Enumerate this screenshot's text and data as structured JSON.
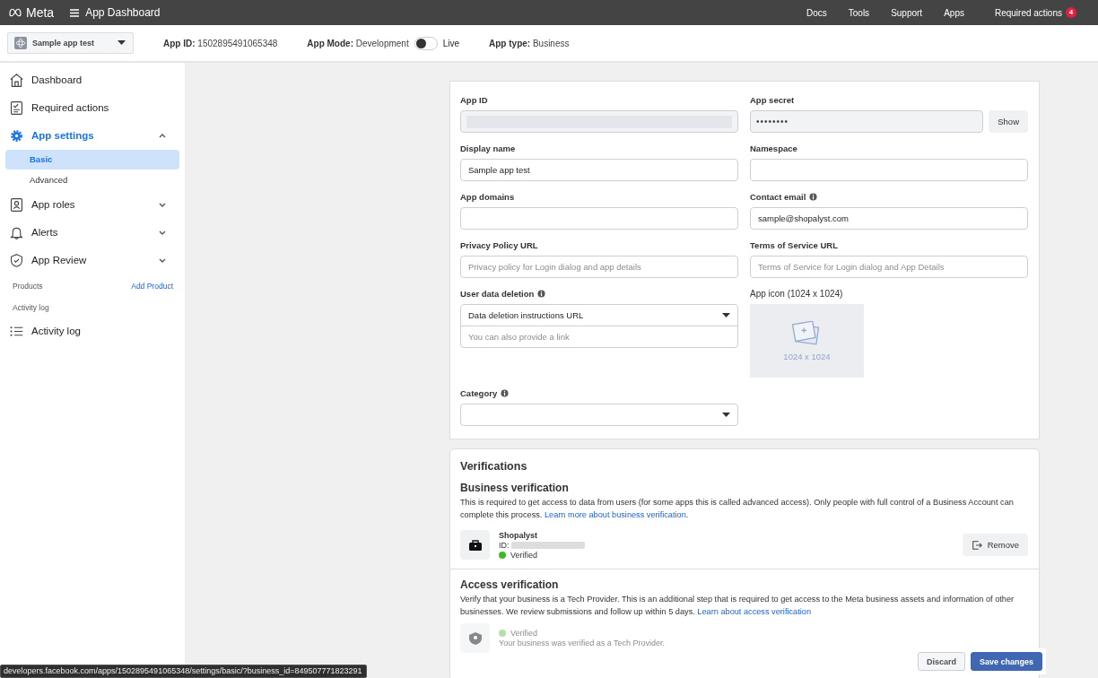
{
  "topbar": {
    "logo": "Meta",
    "title": "App Dashboard",
    "nav": [
      "Docs",
      "Tools",
      "Support",
      "Apps"
    ],
    "required_actions": {
      "label": "Required actions",
      "count": "4"
    }
  },
  "subheader": {
    "app_selector": "Sample app test",
    "app_id": {
      "label": "App ID:",
      "value": "1502895491065348"
    },
    "app_mode": {
      "label": "App Mode:",
      "value": "Development",
      "live_label": "Live",
      "on": false
    },
    "app_type": {
      "label": "App type:",
      "value": "Business"
    }
  },
  "sidebar": {
    "items": [
      {
        "label": "Dashboard",
        "selected": false
      },
      {
        "label": "Required actions",
        "selected": false
      },
      {
        "label": "App settings",
        "selected": true,
        "expanded": true,
        "children": [
          {
            "label": "Basic",
            "selected": true
          },
          {
            "label": "Advanced",
            "selected": false
          }
        ]
      },
      {
        "label": "App roles",
        "selected": false,
        "expanded": false
      },
      {
        "label": "Alerts",
        "selected": false,
        "expanded": false
      },
      {
        "label": "App Review",
        "selected": false,
        "expanded": false
      }
    ],
    "products": {
      "heading": "Products",
      "action": "Add Product"
    },
    "activity": {
      "heading": "Activity log",
      "items": [
        {
          "label": "Activity log"
        }
      ]
    }
  },
  "form": {
    "fields": [
      {
        "kind": "blurred",
        "label": "App ID"
      },
      {
        "kind": "secret",
        "label": "App secret",
        "value": "••••••••",
        "button": "Show"
      },
      {
        "kind": "text",
        "label": "Display name",
        "value": "Sample app test"
      },
      {
        "kind": "text",
        "label": "Namespace"
      },
      {
        "kind": "text",
        "label": "App domains"
      },
      {
        "kind": "text",
        "label": "Contact email",
        "info": true,
        "value": "sample@shopalyst.com"
      },
      {
        "kind": "text",
        "label": "Privacy Policy URL",
        "placeholder": "Privacy policy for Login dialog and app details"
      },
      {
        "kind": "text",
        "label": "Terms of Service URL",
        "placeholder": "Terms of Service for Login dialog and App Details"
      },
      {
        "kind": "select_input",
        "label": "User data deletion",
        "info": true,
        "value": "Data deletion instructions URL",
        "placeholder": "You can also provide a link"
      },
      {
        "kind": "image",
        "label": "App icon (1024 x 1024)",
        "caption": "1024 x 1024"
      },
      {
        "kind": "select",
        "label": "Category",
        "info": true
      }
    ]
  },
  "verifications": {
    "title": "Verifications",
    "sections": [
      {
        "title": "Business verification",
        "text": "This is required to get access to data from users (for some apps this is called advanced access). Only people with full control of a Business Account can complete this process. ",
        "link": "Learn more about business verification",
        "text_after": ".",
        "entity": {
          "name": "Shopalyst",
          "id_label": "ID:",
          "status": "Verified",
          "color": "#42b72a",
          "faded": false
        },
        "button": "Remove"
      },
      {
        "title": "Access verification",
        "text": "Verify that your business is a Tech Provider. This is an additional step that is required to get access to the Meta business assets and information of other businesses. We review submissions and follow up within 5 days. ",
        "link": "Learn about access verification",
        "entity": {
          "status": "Verified",
          "color": "#b5dfa8",
          "note": "Your business was verified as a Tech Provider.",
          "faded": true
        }
      }
    ]
  },
  "footer": {
    "buttons": [
      {
        "label": "Discard",
        "primary": false
      },
      {
        "label": "Save changes",
        "primary": true
      }
    ]
  },
  "status_url": "developers.facebook.com/apps/1502895491065348/settings/basic/?business_id=849507771823291"
}
